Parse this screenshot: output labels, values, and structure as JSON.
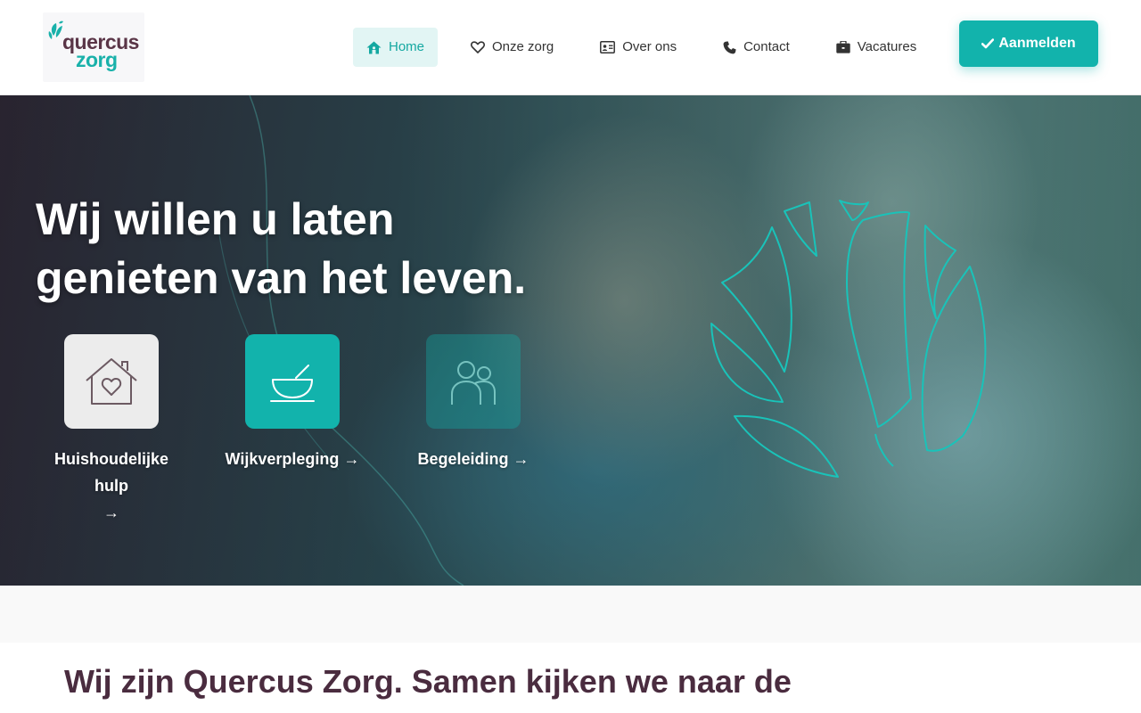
{
  "brand": {
    "logo_line1": "quercus",
    "logo_line2": "zorg",
    "primary_color": "#12b3ac",
    "accent_color": "#4a2c3f"
  },
  "nav": {
    "items": [
      {
        "label": "Home",
        "icon": "home-icon",
        "active": true
      },
      {
        "label": "Onze zorg",
        "icon": "heart-icon",
        "active": false
      },
      {
        "label": "Over ons",
        "icon": "id-card-icon",
        "active": false
      },
      {
        "label": "Contact",
        "icon": "phone-icon",
        "active": false
      },
      {
        "label": "Vacatures",
        "icon": "briefcase-icon",
        "active": false
      }
    ],
    "cta_label": "Aanmelden",
    "cta_icon": "check-icon"
  },
  "hero": {
    "title_line1": "Wij willen u laten",
    "title_line2": "genieten van het leven.",
    "services": [
      {
        "label": "Huishoudelijke hulp",
        "arrow": "→",
        "icon": "house-heart-icon"
      },
      {
        "label": "Wijkverpleging",
        "arrow": "→",
        "icon": "bowl-icon"
      },
      {
        "label": "Begeleiding",
        "arrow": "→",
        "icon": "people-icon"
      }
    ]
  },
  "intro": {
    "heading": "Wij zijn Quercus Zorg. Samen kijken we naar de"
  }
}
